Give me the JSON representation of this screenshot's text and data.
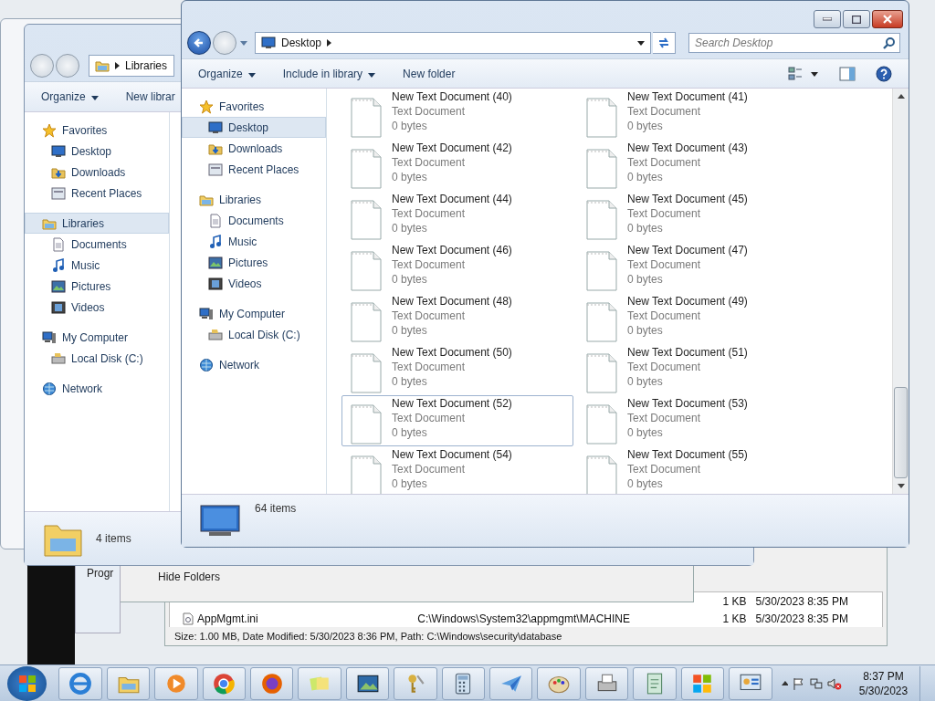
{
  "back_list_window": {
    "rows": [
      {
        "size": "1 KB",
        "modified": "5/30/2023 8:35 PM"
      },
      {
        "name": "AppMgmt.ini",
        "path": "C:\\Windows\\System32\\appmgmt\\MACHINE",
        "size": "1 KB",
        "modified": "5/30/2023 8:35 PM"
      }
    ],
    "status": "Size: 1.00 MB, Date Modified: 5/30/2023 8:36 PM, Path: C:\\Windows\\security\\database"
  },
  "back_dialog": {
    "toggle": "Hide Folders",
    "label": "Progr"
  },
  "libraries_window": {
    "address": "Libraries",
    "toolbar": [
      "Organize",
      "New librar"
    ],
    "sidebar": [
      {
        "label": "Favorites",
        "kind": "star",
        "selected": false,
        "children": [
          {
            "label": "Desktop",
            "kind": "desktop",
            "selected": false
          },
          {
            "label": "Downloads",
            "kind": "downloads",
            "selected": false
          },
          {
            "label": "Recent Places",
            "kind": "recent",
            "selected": false
          }
        ]
      },
      {
        "label": "Libraries",
        "kind": "library",
        "selected": true,
        "children": [
          {
            "label": "Documents",
            "kind": "documents",
            "selected": false
          },
          {
            "label": "Music",
            "kind": "music",
            "selected": false
          },
          {
            "label": "Pictures",
            "kind": "pictures",
            "selected": false
          },
          {
            "label": "Videos",
            "kind": "videos",
            "selected": false
          }
        ]
      },
      {
        "label": "My Computer",
        "kind": "computer",
        "selected": false,
        "children": [
          {
            "label": "Local Disk (C:)",
            "kind": "disk",
            "selected": false
          }
        ]
      },
      {
        "label": "Network",
        "kind": "network",
        "selected": false
      }
    ],
    "status": "4 items"
  },
  "explorer_window": {
    "address": "Desktop",
    "search": {
      "placeholder": "Search Desktop"
    },
    "toolbar": [
      "Organize",
      "Include in library",
      "New folder"
    ],
    "sidebar": [
      {
        "label": "Favorites",
        "kind": "star",
        "selected": false,
        "children": [
          {
            "label": "Desktop",
            "kind": "desktop",
            "selected": true
          },
          {
            "label": "Downloads",
            "kind": "downloads",
            "selected": false
          },
          {
            "label": "Recent Places",
            "kind": "recent",
            "selected": false
          }
        ]
      },
      {
        "label": "Libraries",
        "kind": "library",
        "selected": false,
        "children": [
          {
            "label": "Documents",
            "kind": "documents",
            "selected": false
          },
          {
            "label": "Music",
            "kind": "music",
            "selected": false
          },
          {
            "label": "Pictures",
            "kind": "pictures",
            "selected": false
          },
          {
            "label": "Videos",
            "kind": "videos",
            "selected": false
          }
        ]
      },
      {
        "label": "My Computer",
        "kind": "computer",
        "selected": false,
        "children": [
          {
            "label": "Local Disk (C:)",
            "kind": "disk",
            "selected": false
          }
        ]
      },
      {
        "label": "Network",
        "kind": "network",
        "selected": false
      }
    ],
    "files": [
      {
        "name": "New Text Document (40)",
        "type": "Text Document",
        "size": "0 bytes",
        "selected": false
      },
      {
        "name": "New Text Document (41)",
        "type": "Text Document",
        "size": "0 bytes",
        "selected": false
      },
      {
        "name": "New Text Document (42)",
        "type": "Text Document",
        "size": "0 bytes",
        "selected": false
      },
      {
        "name": "New Text Document (43)",
        "type": "Text Document",
        "size": "0 bytes",
        "selected": false
      },
      {
        "name": "New Text Document (44)",
        "type": "Text Document",
        "size": "0 bytes",
        "selected": false
      },
      {
        "name": "New Text Document (45)",
        "type": "Text Document",
        "size": "0 bytes",
        "selected": false
      },
      {
        "name": "New Text Document (46)",
        "type": "Text Document",
        "size": "0 bytes",
        "selected": false
      },
      {
        "name": "New Text Document (47)",
        "type": "Text Document",
        "size": "0 bytes",
        "selected": false
      },
      {
        "name": "New Text Document (48)",
        "type": "Text Document",
        "size": "0 bytes",
        "selected": false
      },
      {
        "name": "New Text Document (49)",
        "type": "Text Document",
        "size": "0 bytes",
        "selected": false
      },
      {
        "name": "New Text Document (50)",
        "type": "Text Document",
        "size": "0 bytes",
        "selected": false
      },
      {
        "name": "New Text Document (51)",
        "type": "Text Document",
        "size": "0 bytes",
        "selected": false
      },
      {
        "name": "New Text Document (52)",
        "type": "Text Document",
        "size": "0 bytes",
        "selected": true
      },
      {
        "name": "New Text Document (53)",
        "type": "Text Document",
        "size": "0 bytes",
        "selected": false
      },
      {
        "name": "New Text Document (54)",
        "type": "Text Document",
        "size": "0 bytes",
        "selected": false
      },
      {
        "name": "New Text Document (55)",
        "type": "Text Document",
        "size": "0 bytes",
        "selected": false
      }
    ],
    "status": "64 items"
  },
  "taskbar": {
    "time": "8:37 PM",
    "date": "5/30/2023"
  }
}
